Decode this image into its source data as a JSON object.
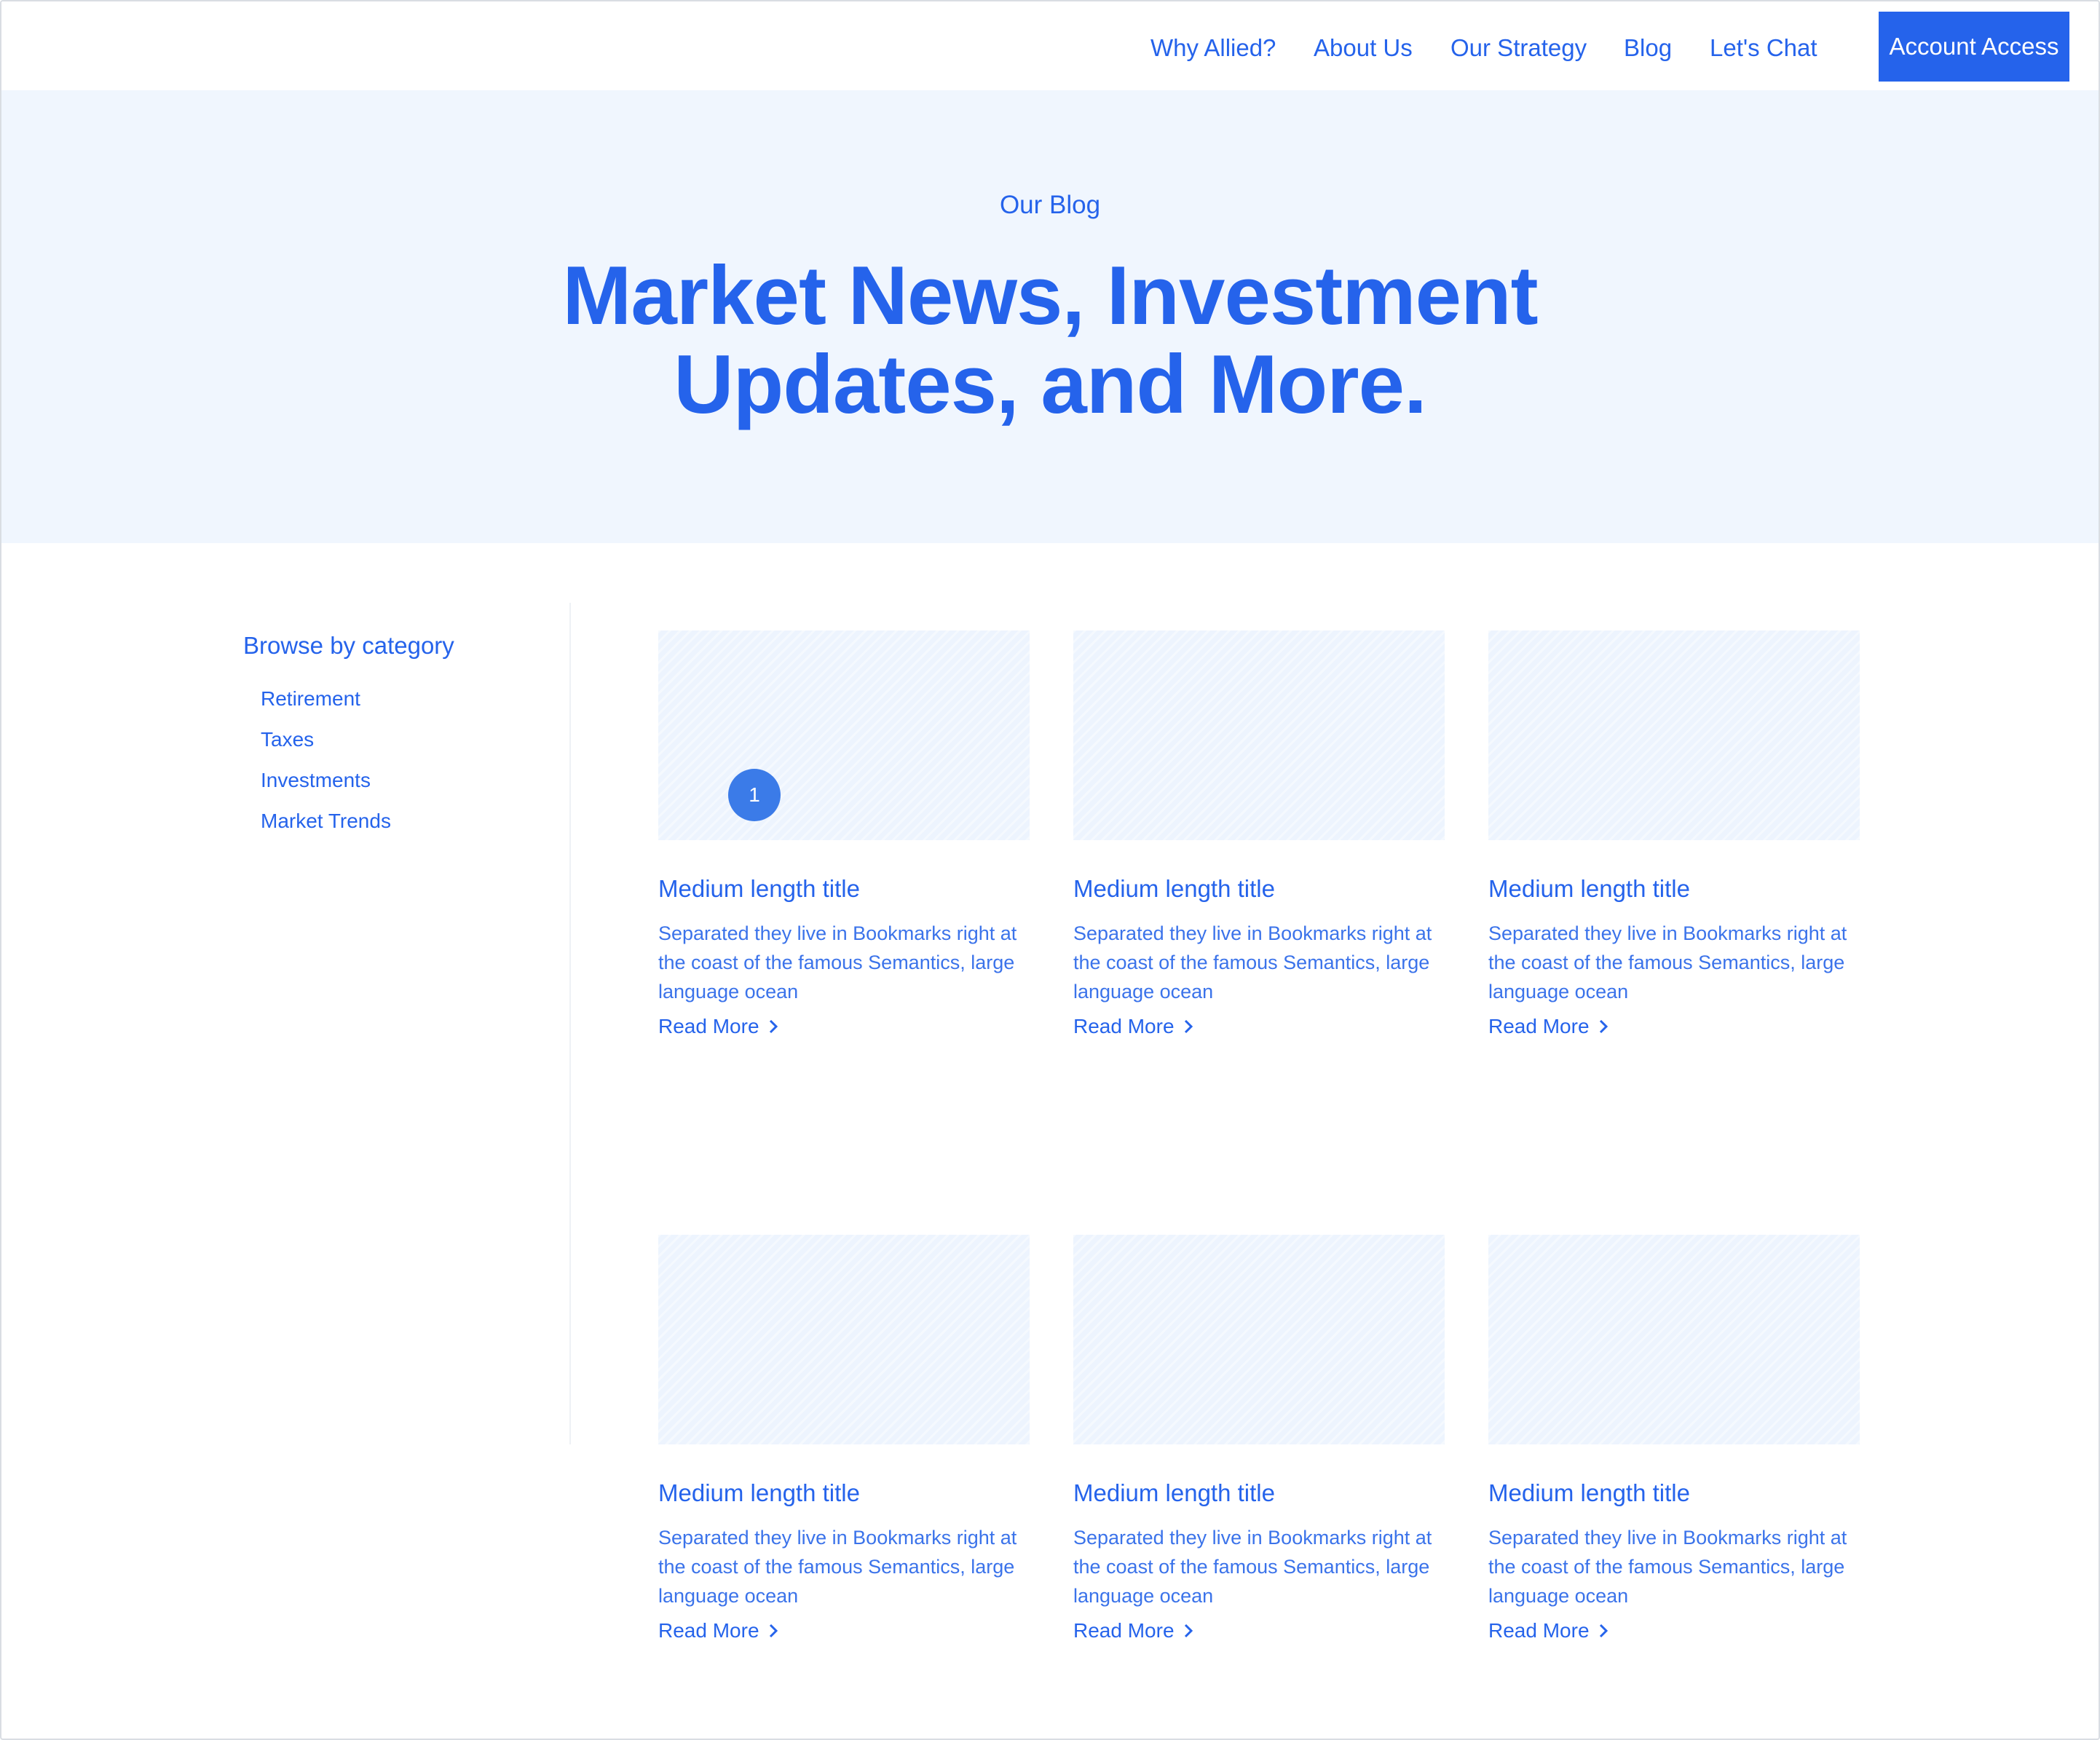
{
  "nav": {
    "links": [
      "Why Allied?",
      "About Us",
      "Our Strategy",
      "Blog",
      "Let's Chat"
    ],
    "account_button": "Account Access"
  },
  "hero": {
    "eyebrow": "Our Blog",
    "title_line1": "Market News, Investment",
    "title_line2": "Updates, and More."
  },
  "sidebar": {
    "heading": "Browse by category",
    "categories": [
      "Retirement",
      "Taxes",
      "Investments",
      "Market Trends"
    ]
  },
  "cards": [
    {
      "title": "Medium length title",
      "description": "Separated they live in Bookmarks right at the coast of the famous Semantics, large language ocean",
      "link": "Read More",
      "badge": "1"
    },
    {
      "title": "Medium length title",
      "description": "Separated they live in Bookmarks right at the coast of the famous Semantics, large language ocean",
      "link": "Read More"
    },
    {
      "title": "Medium length title",
      "description": "Separated they live in Bookmarks right at the coast of the famous Semantics, large language ocean",
      "link": "Read More"
    },
    {
      "title": "Medium length title",
      "description": "Separated they live in Bookmarks right at the coast of the famous Semantics, large language ocean",
      "link": "Read More"
    },
    {
      "title": "Medium length title",
      "description": "Separated they live in Bookmarks right at the coast of the famous Semantics, large language ocean",
      "link": "Read More"
    },
    {
      "title": "Medium length title",
      "description": "Separated they live in Bookmarks right at the coast of the famous Semantics, large language ocean",
      "link": "Read More"
    }
  ],
  "colors": {
    "accent": "#2563eb",
    "hero_background": "#f0f6fe",
    "image_placeholder": "#edf4fe"
  },
  "icons": {
    "read_more": "chevron-right-icon"
  }
}
